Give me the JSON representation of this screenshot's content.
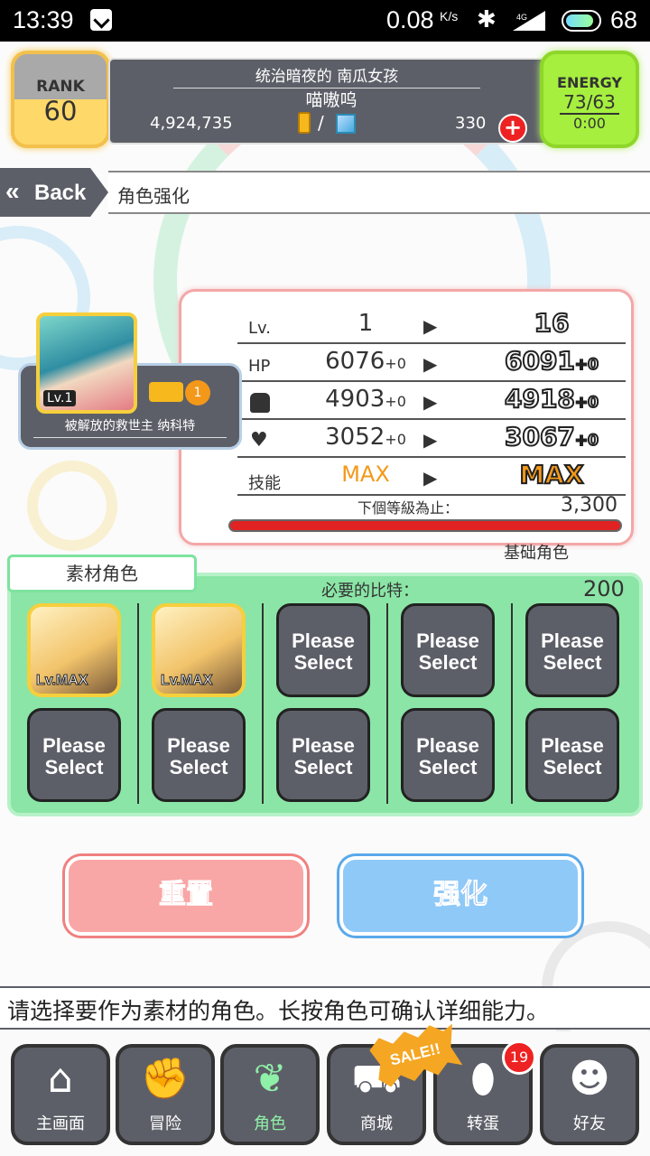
{
  "status_bar": {
    "time": "13:39",
    "speed": "0.08",
    "speed_unit": "K/s",
    "network": "4G",
    "battery": "68"
  },
  "header": {
    "rank_label": "RANK",
    "rank_value": "60",
    "player_title": "统治暗夜的 南瓜女孩",
    "player_name": "喵嗷呜",
    "gold": "4,924,735",
    "separator": "/",
    "gems": "330",
    "energy_label": "ENERGY",
    "energy_value": "73/63",
    "energy_timer": "0:00"
  },
  "nav": {
    "back_label": "Back",
    "page_title": "角色强化"
  },
  "character": {
    "level_tag": "Lv.1",
    "badge": "1",
    "name": "被解放的救世主 纳科特"
  },
  "stats": {
    "rows": [
      {
        "label": "Lv.",
        "from": "1",
        "from_bonus": "",
        "to": "16",
        "to_bonus": ""
      },
      {
        "label": "HP",
        "from": "6076",
        "from_bonus": "+0",
        "to": "6091",
        "to_bonus": "+0"
      },
      {
        "label": "",
        "icon": "fist-icon",
        "from": "4903",
        "from_bonus": "+0",
        "to": "4918",
        "to_bonus": "+0"
      },
      {
        "label": "",
        "icon": "heart-icon",
        "from": "3052",
        "from_bonus": "+0",
        "to": "3067",
        "to_bonus": "+0"
      },
      {
        "label": "技能",
        "from": "MAX",
        "from_bonus": "",
        "to": "MAX",
        "to_bonus": ""
      }
    ],
    "next_level_label": "下個等級為止：",
    "next_level_value": "3,300",
    "exp_progress": 0.99,
    "base_label": "基础角色"
  },
  "materials": {
    "tab_label": "素材角色",
    "required_label": "必要的比特：",
    "required_value": "200",
    "slots": [
      {
        "filled": true,
        "level": "Lv.MAX"
      },
      {
        "filled": true,
        "level": "Lv.MAX"
      },
      {
        "filled": false,
        "label": "Please Select"
      },
      {
        "filled": false,
        "label": "Please Select"
      },
      {
        "filled": false,
        "label": "Please Select"
      },
      {
        "filled": false,
        "label": "Please Select"
      },
      {
        "filled": false,
        "label": "Please Select"
      },
      {
        "filled": false,
        "label": "Please Select"
      },
      {
        "filled": false,
        "label": "Please Select"
      },
      {
        "filled": false,
        "label": "Please Select"
      }
    ]
  },
  "actions": {
    "reset_label": "重置",
    "enhance_label": "强化"
  },
  "hint": "请选择要作为素材的角色。长按角色可确认详细能力。",
  "bottom_nav": {
    "tabs": [
      {
        "label": "主画面",
        "icon": "home-icon"
      },
      {
        "label": "冒险",
        "icon": "handshake-icon"
      },
      {
        "label": "角色",
        "icon": "rabbit-icon"
      },
      {
        "label": "商城",
        "icon": "cart-icon"
      },
      {
        "label": "转蛋",
        "icon": "egg-icon"
      },
      {
        "label": "好友",
        "icon": "friends-icon"
      }
    ],
    "sale_label": "SALE!!",
    "notification_count": "19"
  },
  "colors": {
    "panel_dark": "#5d5f68",
    "rank_gold": "#ffd86a",
    "energy_green": "#a6ef3f",
    "materials_green": "#8be5a6",
    "reset_red": "#f9a6a6",
    "enhance_blue": "#8fc9f8"
  }
}
